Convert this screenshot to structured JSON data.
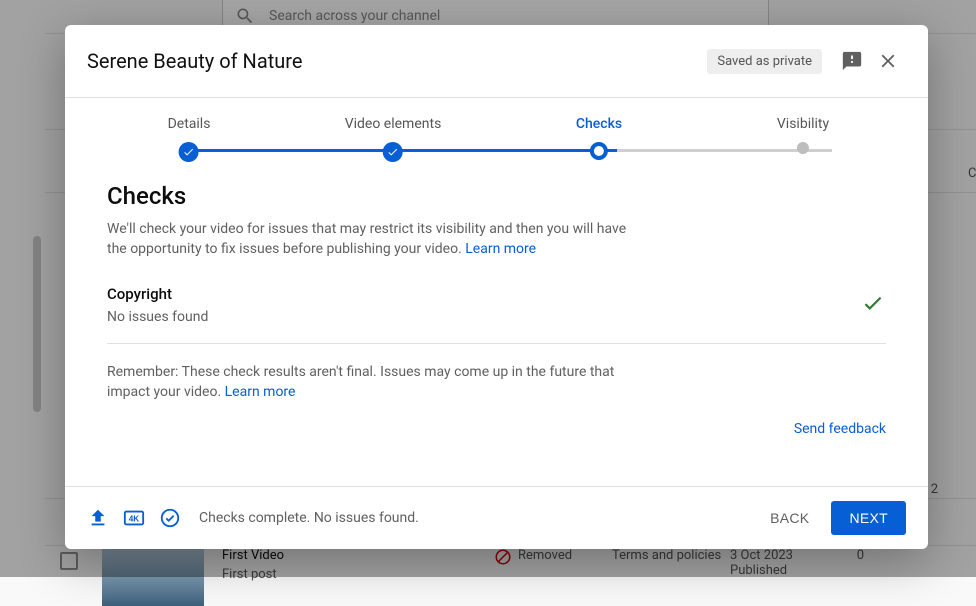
{
  "search": {
    "placeholder": "Search across your channel"
  },
  "modal": {
    "title": "Serene Beauty of Nature",
    "saved_chip": "Saved as private",
    "steps": {
      "s1": "Details",
      "s2": "Video elements",
      "s3": "Checks",
      "s4": "Visibility"
    },
    "body": {
      "heading": "Checks",
      "desc_prefix": "We'll check your video for issues that may restrict its visibility and then you will have the opportunity to fix issues before publishing your video. ",
      "learn_more": "Learn more",
      "copyright_title": "Copyright",
      "copyright_status": "No issues found",
      "remember_prefix": "Remember: These check results aren't final. Issues may come up in the future that impact your video. ",
      "send_feedback": "Send feedback"
    },
    "footer": {
      "status": "Checks complete. No issues found.",
      "back": "BACK",
      "next": "NEXT"
    }
  },
  "bg_row": {
    "title": "First Video",
    "subtitle": "First post",
    "removed": "Removed",
    "terms": "Terms and policies",
    "date": "3 Oct 2023",
    "published": "Published",
    "zero": "0",
    "two": "2",
    "c": "C"
  }
}
